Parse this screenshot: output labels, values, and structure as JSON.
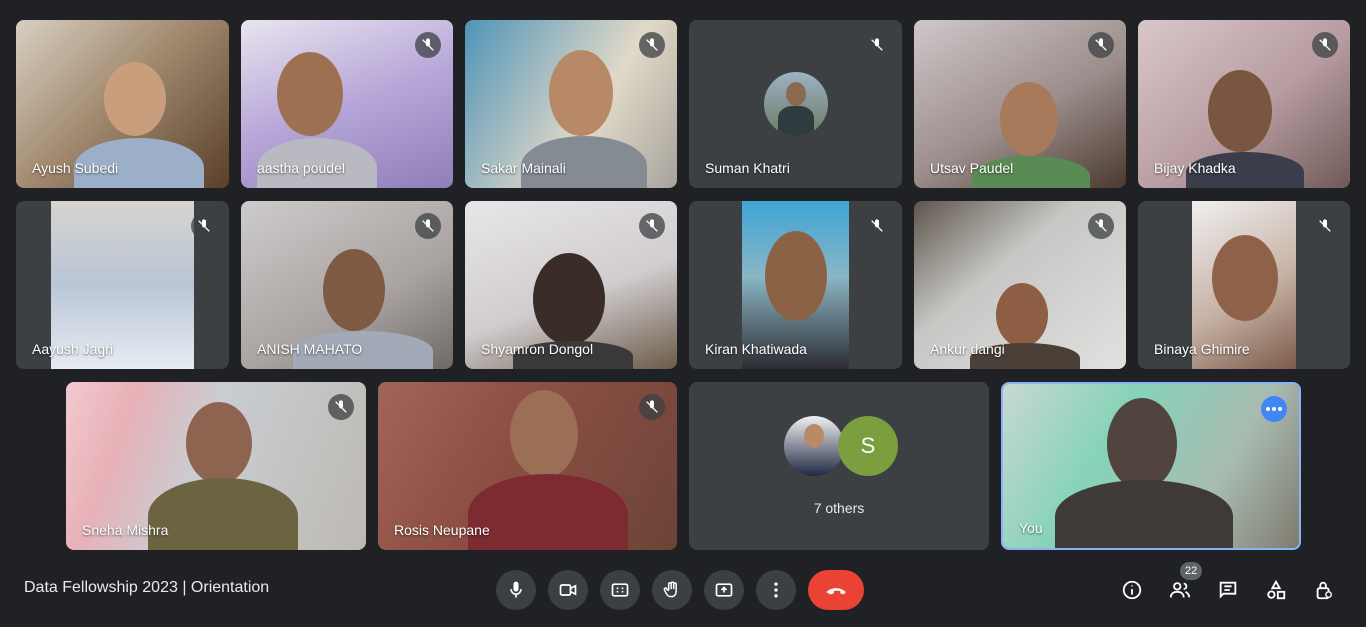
{
  "meeting": {
    "title": "Data Fellowship 2023 | Orientation"
  },
  "participants": [
    {
      "name": "Ayush Subedi"
    },
    {
      "name": "aastha poudel"
    },
    {
      "name": "Sakar Mainali"
    },
    {
      "name": "Suman Khatri"
    },
    {
      "name": "Utsav Paudel"
    },
    {
      "name": "Bijay Khadka"
    },
    {
      "name": "Aayush Jagri"
    },
    {
      "name": "ANISH MAHATO"
    },
    {
      "name": "Shyamron Dongol"
    },
    {
      "name": "Kiran Khatiwada"
    },
    {
      "name": "Ankur dangi"
    },
    {
      "name": "Binaya Ghimire"
    },
    {
      "name": "Sneha Mishra"
    },
    {
      "name": "Rosis Neupane"
    }
  ],
  "others": {
    "label": "7 others",
    "initial": "S"
  },
  "self": {
    "name": "You"
  },
  "toolbar": {
    "people_count": "22"
  },
  "colors": {
    "hangup": "#ea4335",
    "accent": "#4285f4",
    "others_avatar": "#7b9e3f"
  },
  "icons": [
    "microphone-icon",
    "camera-icon",
    "captions-icon",
    "raise-hand-icon",
    "present-screen-icon",
    "more-options-icon",
    "hangup-icon",
    "info-icon",
    "people-icon",
    "chat-icon",
    "activities-icon",
    "host-controls-icon",
    "muted-mic-icon"
  ]
}
